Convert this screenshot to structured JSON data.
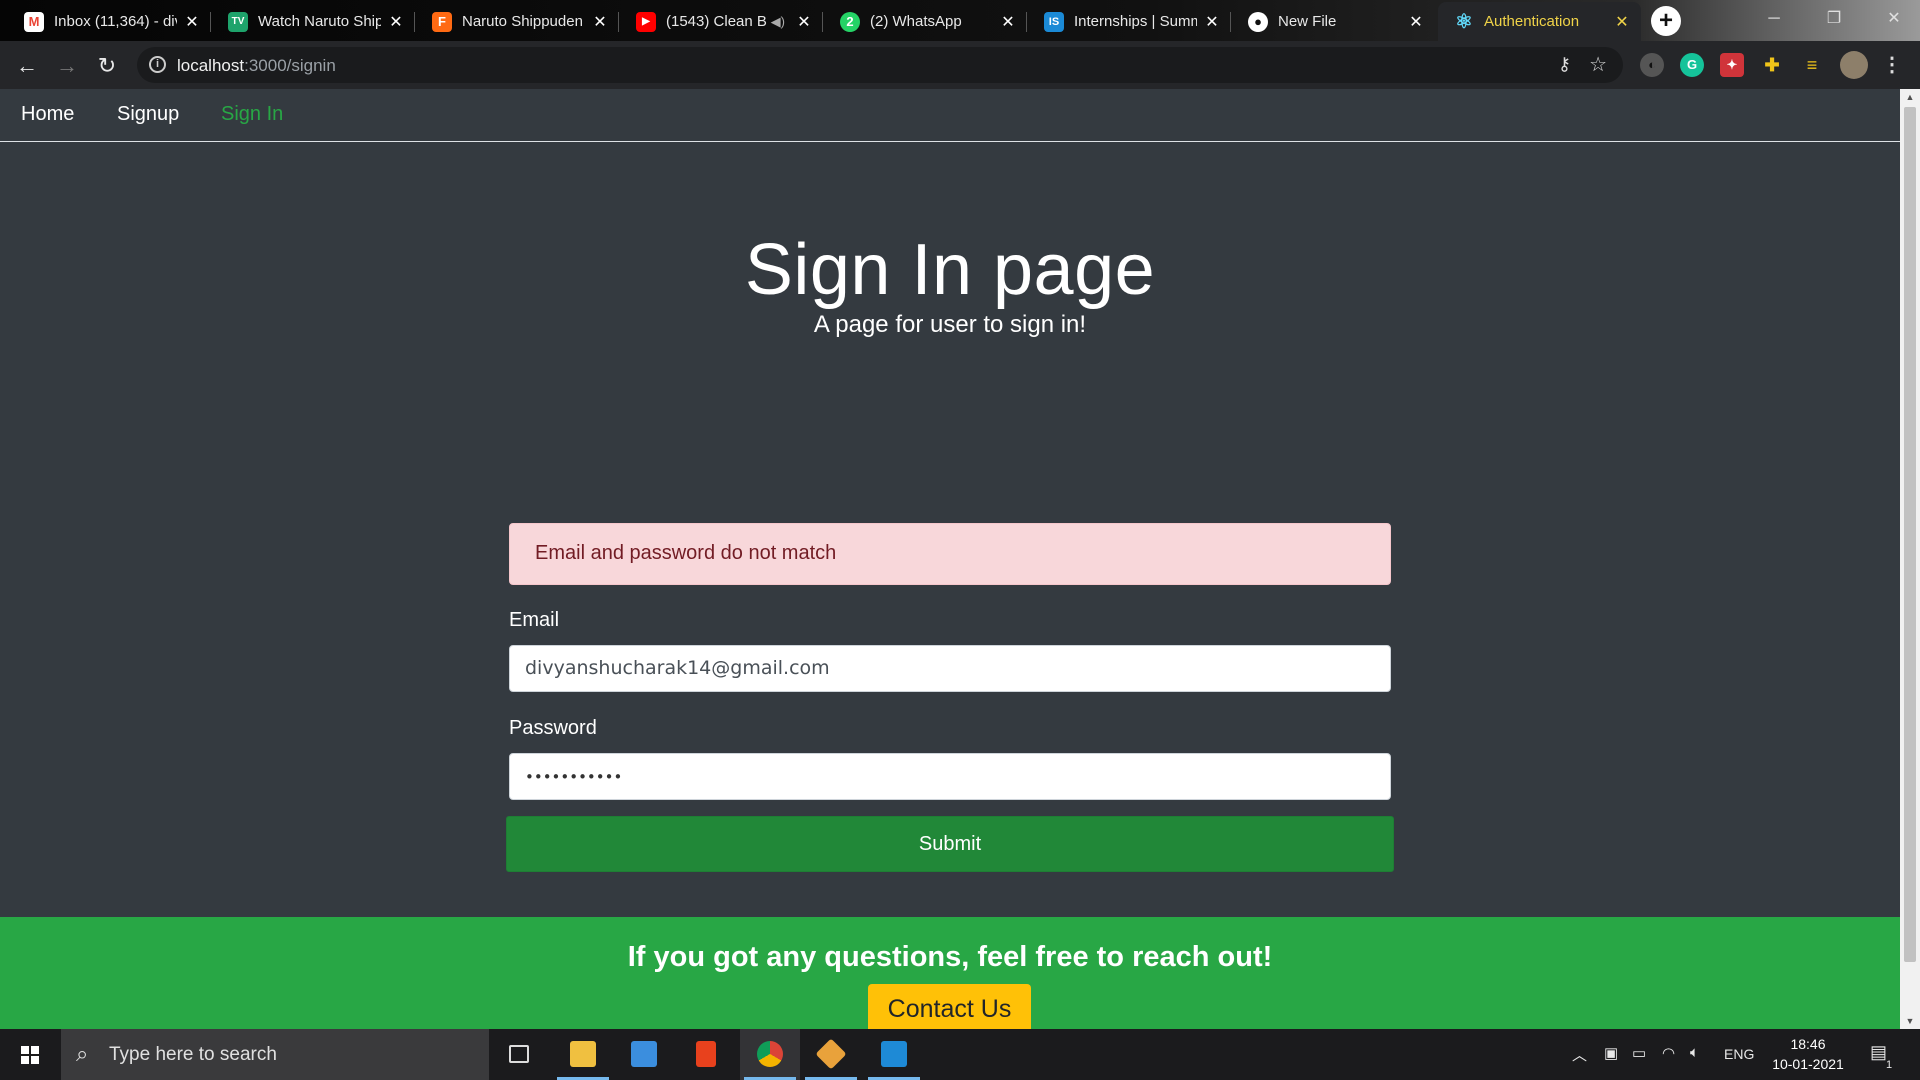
{
  "browser": {
    "tabs": [
      {
        "title": "Inbox (11,364) - div",
        "icon": "gmail-icon",
        "color": "#ea4335",
        "glyph": "M"
      },
      {
        "title": "Watch Naruto Shippuden",
        "icon": "tv-icon",
        "color": "#1ea36b",
        "glyph": "TV"
      },
      {
        "title": "Naruto Shippuden",
        "icon": "f-logo-icon",
        "color": "#ff6a13",
        "glyph": "F"
      },
      {
        "title": "(1543) Clean B",
        "icon": "youtube-icon",
        "color": "#ff0000",
        "glyph": "▶"
      },
      {
        "title": "(2) WhatsApp",
        "icon": "whatsapp-icon",
        "color": "#25d366",
        "glyph": "2"
      },
      {
        "title": "Internships | Summ",
        "icon": "internshala-icon",
        "color": "#1b8ad6",
        "glyph": "IS"
      },
      {
        "title": "New File",
        "icon": "github-icon",
        "color": "#24292e",
        "glyph": "●"
      },
      {
        "title": "Authentication",
        "icon": "react-icon",
        "color": "#61dafb",
        "glyph": "⚛"
      }
    ],
    "url_host": "localhost",
    "url_path": ":3000/signin"
  },
  "nav": {
    "items": [
      "Home",
      "Signup",
      "Sign In"
    ],
    "active": "Sign In"
  },
  "jumbotron": {
    "title": "Sign In page",
    "subtitle": "A page for user to sign in!"
  },
  "form": {
    "alert": "Email and password do not match",
    "email_label": "Email",
    "email_value": "divyanshucharak14@gmail.com",
    "password_label": "Password",
    "password_value": "•••••••••••",
    "submit_label": "Submit"
  },
  "footer": {
    "text": "If you got any questions, feel free to reach out!",
    "contact_label": "Contact Us"
  },
  "taskbar": {
    "search_placeholder": "Type here to search",
    "language": "ENG",
    "time": "18:46",
    "date": "10-01-2021",
    "notification_count": "1"
  },
  "colors": {
    "page_bg": "#343a40",
    "active_link": "#28a745",
    "alert_bg": "#f8d7da",
    "submit_bg": "#218838",
    "footer_bg": "#28a745",
    "contact_bg": "#ffc107"
  }
}
